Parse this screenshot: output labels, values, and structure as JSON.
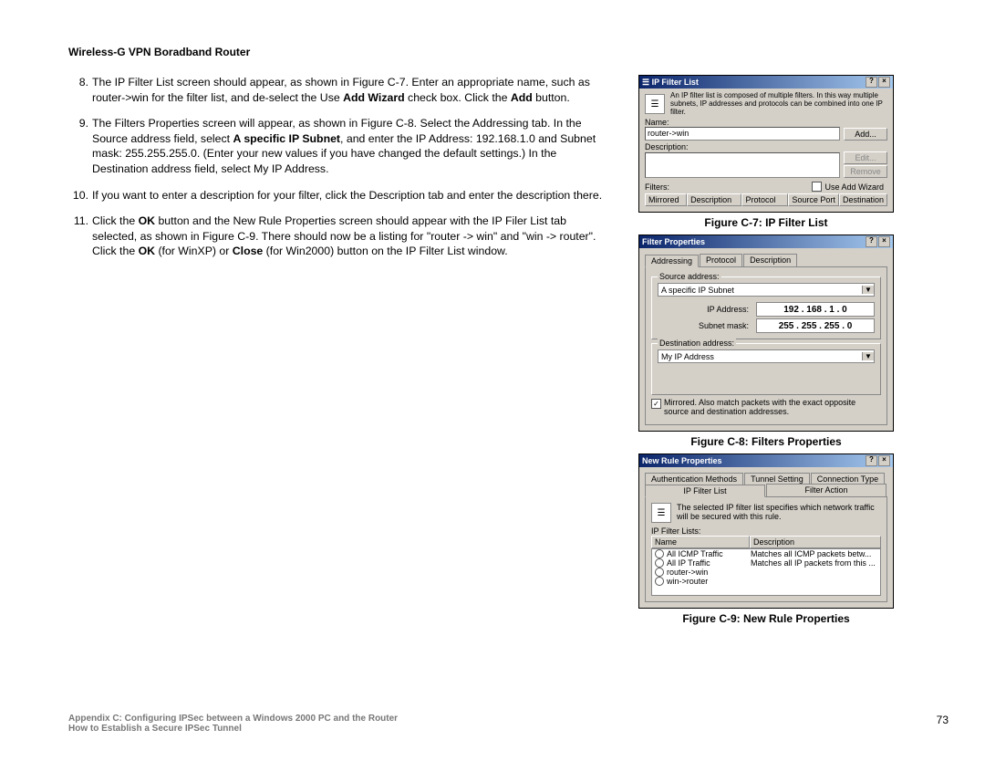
{
  "header": "Wireless-G VPN Boradband Router",
  "steps": [
    {
      "num": "8.",
      "html": "The IP Filter List screen should appear, as shown in Figure C-7. Enter an appropriate name, such as router->win for the filter list,  and de-select the Use <b>Add Wizard</b> check box. Click the <b>Add</b> button."
    },
    {
      "num": "9.",
      "html": "The Filters Properties screen will appear, as shown in Figure C-8. Select the Addressing tab. In the Source address field, select <b>A specific IP Subnet</b>, and enter the IP Address: 192.168.1.0 and Subnet mask: 255.255.255.0. (Enter your new values if you have changed the default settings.) In the Destination address field, select My IP Address."
    },
    {
      "num": "10.",
      "html": "If you want to enter a description for your filter, click the Description tab and enter the description there."
    },
    {
      "num": "11.",
      "html": "Click the <b>OK</b> button and the New Rule Properties screen should appear with the IP Filer List tab selected, as shown in Figure C-9. There should now be a listing for \"router -> win\" and \"win -> router\". Click the <b>OK</b> (for WinXP) or <b>Close</b> (for Win2000) button on the IP Filter List window."
    }
  ],
  "fig7": {
    "title": "IP Filter List",
    "info": "An IP filter list is composed of multiple filters. In this way multiple subnets, IP addresses and protocols can be combined into one IP filter.",
    "name_lbl": "Name:",
    "name_val": "router->win",
    "desc_lbl": "Description:",
    "filters_lbl": "Filters:",
    "wizard": "Use Add Wizard",
    "add": "Add...",
    "edit": "Edit...",
    "remove": "Remove",
    "cols": {
      "mirrored": "Mirrored",
      "desc": "Description",
      "proto": "Protocol",
      "sport": "Source Port",
      "dest": "Destination"
    },
    "caption": "Figure C-7: IP Filter List"
  },
  "fig8": {
    "title": "Filter Properties",
    "tabs": {
      "addr": "Addressing",
      "proto": "Protocol",
      "desc": "Description"
    },
    "src_grp": "Source address:",
    "src_combo": "A specific IP Subnet",
    "ip_lbl": "IP Address:",
    "ip_val": "192 . 168 .   1 .   0",
    "mask_lbl": "Subnet mask:",
    "mask_val": "255 . 255 . 255 .   0",
    "dst_grp": "Destination address:",
    "dst_combo": "My IP Address",
    "mirrored": "Mirrored. Also match packets with the exact opposite source and destination addresses.",
    "caption": "Figure C-8: Filters Properties"
  },
  "fig9": {
    "title": "New Rule Properties",
    "tabs": {
      "auth": "Authentication Methods",
      "tunnel": "Tunnel Setting",
      "conn": "Connection Type",
      "ipfl": "IP Filter List",
      "fa": "Filter Action"
    },
    "hint": "The selected IP filter list specifies which network traffic will be secured with this rule.",
    "grp": "IP Filter Lists:",
    "col_name": "Name",
    "col_desc": "Description",
    "rows": [
      {
        "n": "All ICMP Traffic",
        "d": "Matches all ICMP packets betw..."
      },
      {
        "n": "All IP Traffic",
        "d": "Matches all IP packets from this ..."
      },
      {
        "n": "router->win",
        "d": ""
      },
      {
        "n": "win->router",
        "d": ""
      }
    ],
    "caption": "Figure C-9: New Rule Properties"
  },
  "footer": {
    "appendix": "Appendix C: Configuring IPSec between a Windows 2000 PC and the Router",
    "sub": "How to Establish a Secure IPSec Tunnel",
    "page": "73"
  }
}
